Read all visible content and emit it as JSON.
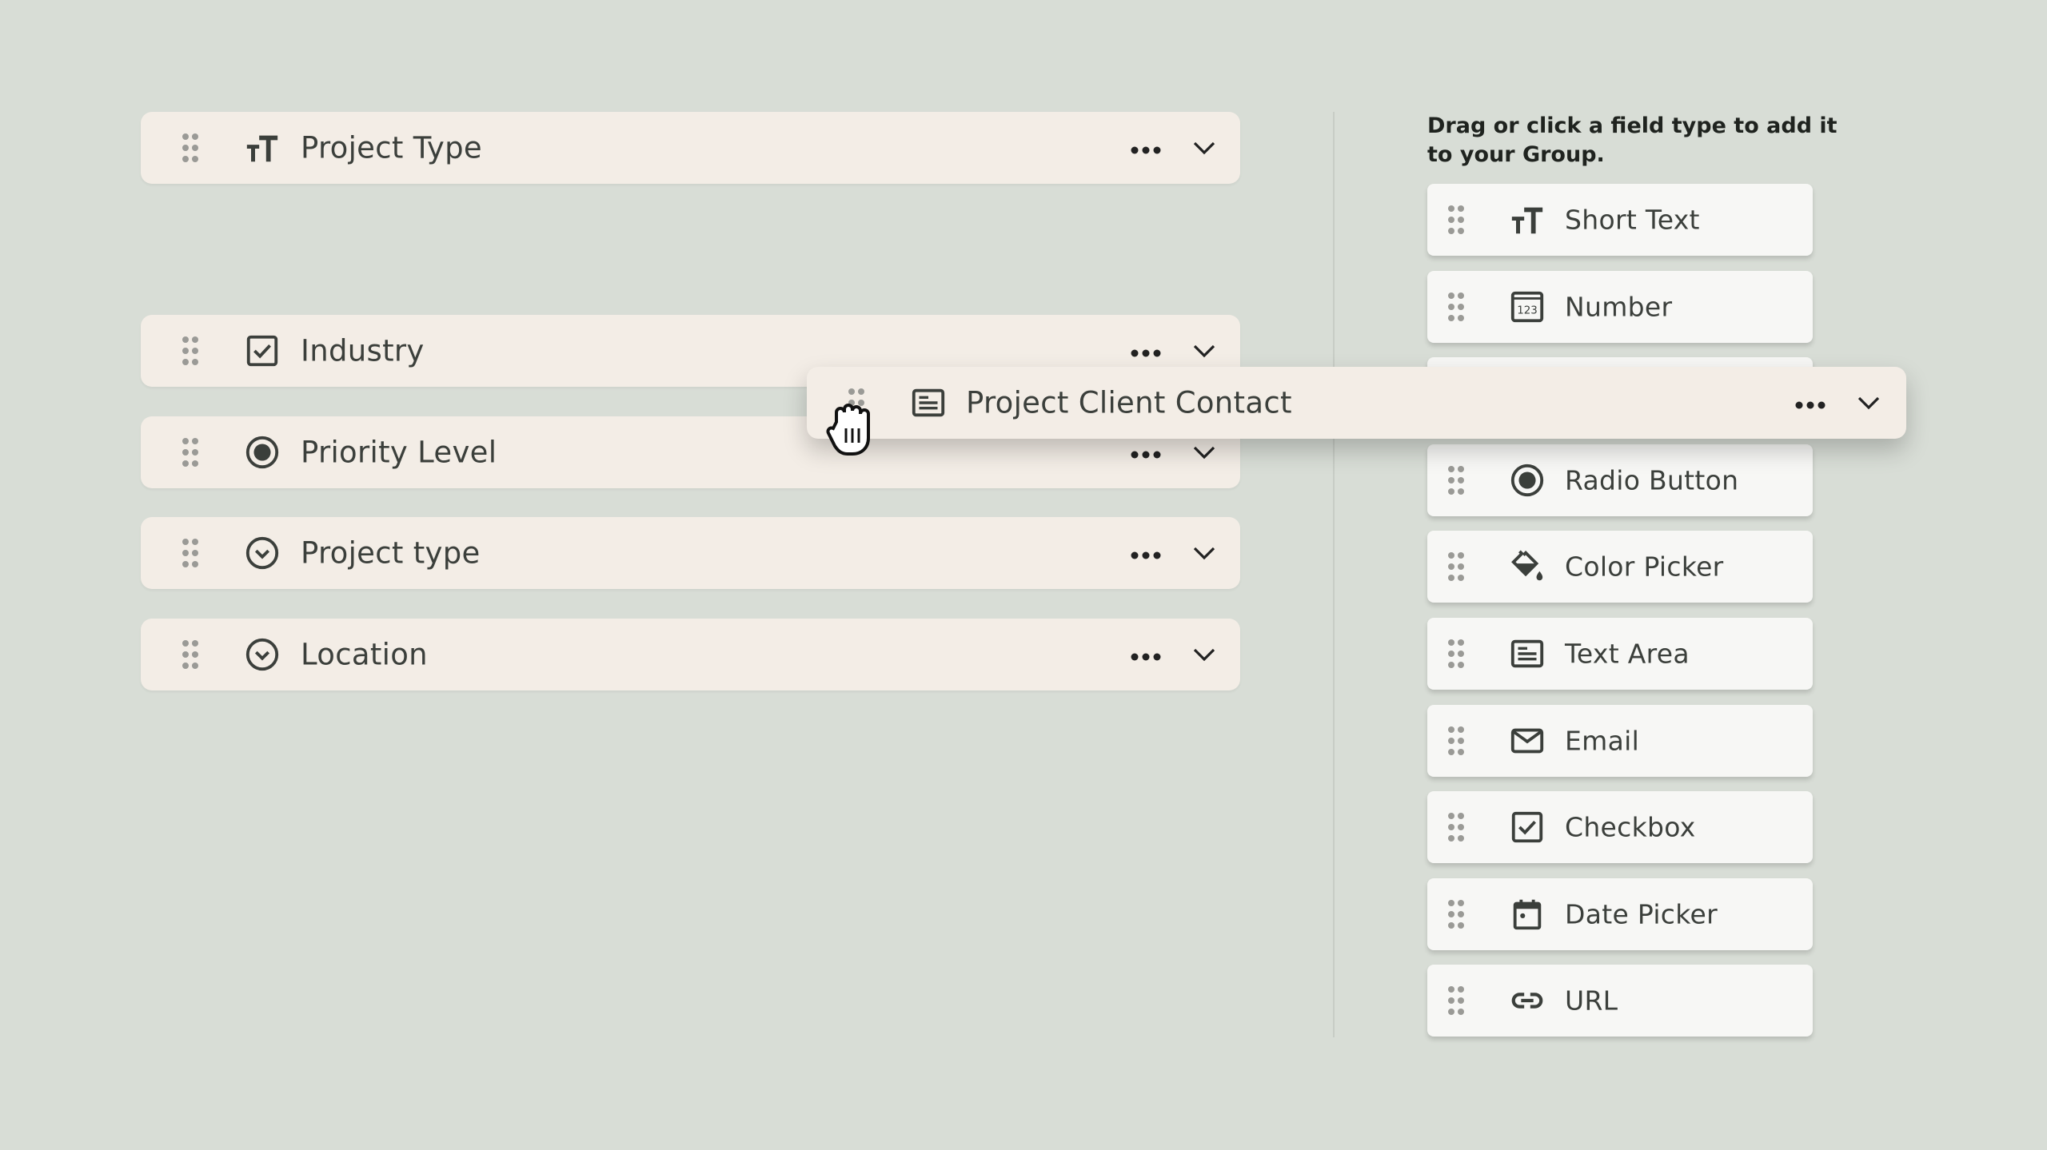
{
  "group_fields": [
    {
      "label": "Project Type",
      "icon": "text-type-icon"
    },
    {
      "label": "Industry",
      "icon": "checkbox-icon"
    },
    {
      "label": "Priority Level",
      "icon": "radio-icon"
    },
    {
      "label": "Project type",
      "icon": "dropdown-icon"
    },
    {
      "label": "Location",
      "icon": "dropdown-icon"
    }
  ],
  "dragging_field": {
    "label": "Project Client Contact",
    "icon": "text-area-icon"
  },
  "palette": {
    "hint": "Drag or click a field type to add it to your Group.",
    "items": [
      {
        "label": "Short Text",
        "icon": "text-type-icon"
      },
      {
        "label": "Number",
        "icon": "number-icon"
      },
      {
        "label": "",
        "icon": ""
      },
      {
        "label": "Radio Button",
        "icon": "radio-icon"
      },
      {
        "label": "Color Picker",
        "icon": "color-picker-icon"
      },
      {
        "label": "Text Area",
        "icon": "text-area-icon"
      },
      {
        "label": "Email",
        "icon": "email-icon"
      },
      {
        "label": "Checkbox",
        "icon": "checkbox-icon"
      },
      {
        "label": "Date Picker",
        "icon": "calendar-icon"
      },
      {
        "label": "URL",
        "icon": "link-icon"
      }
    ]
  },
  "colors": {
    "background": "#d8ddd6",
    "row": "#f3ede6",
    "card": "#f7f7f5",
    "text": "#3b3f3b",
    "handle": "#9a9a96"
  }
}
